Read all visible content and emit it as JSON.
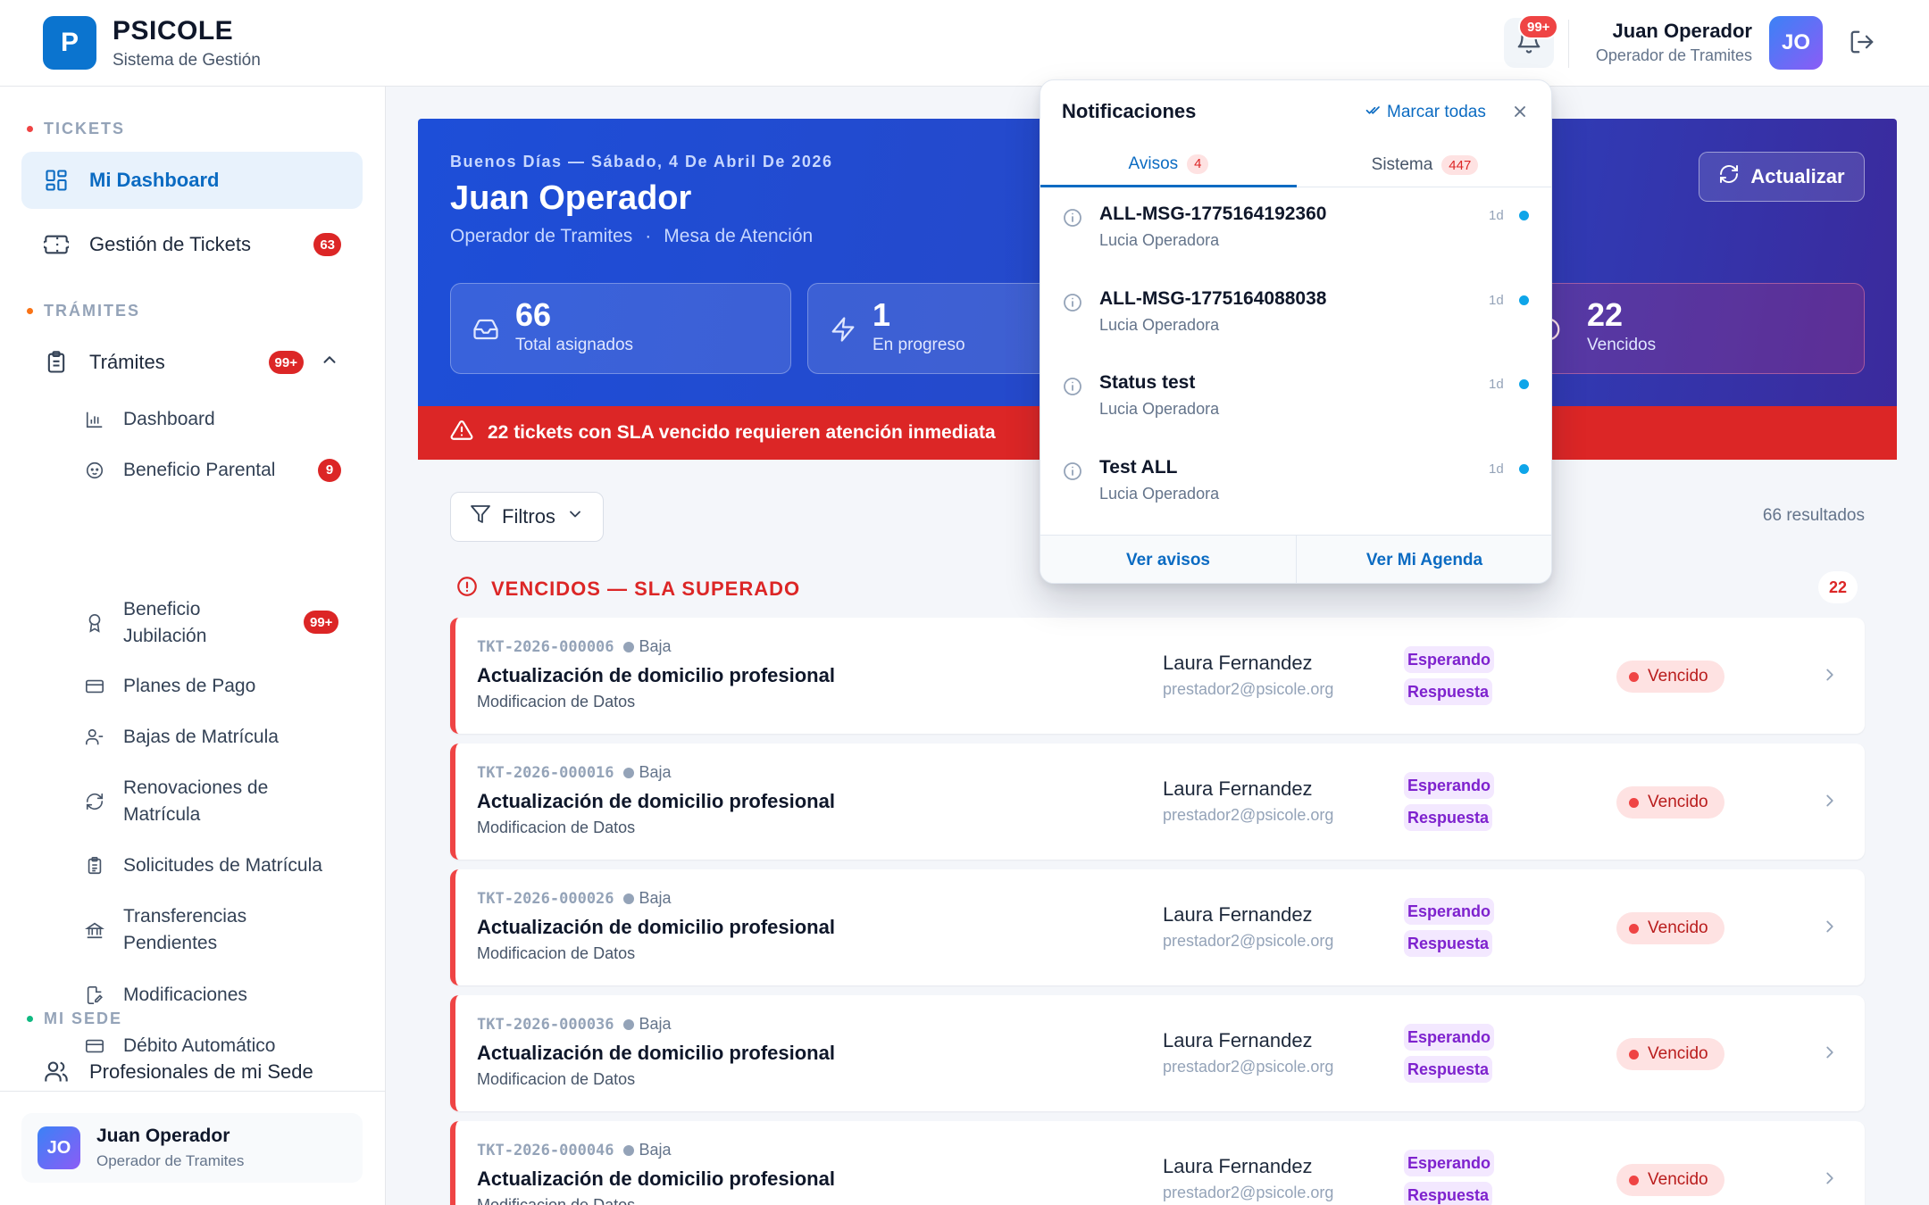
{
  "brand": {
    "logo_letter": "P",
    "name": "PSICOLE",
    "subtitle": "Sistema de Gestión"
  },
  "topbar": {
    "notification_badge": "99+",
    "user_name": "Juan Operador",
    "user_role": "Operador de Tramites",
    "user_initials": "JO"
  },
  "sidebar": {
    "sections": [
      {
        "title": "TICKETS",
        "dot_color": "#ef4444"
      },
      {
        "title": "TRÁMITES",
        "dot_color": "#f97316"
      },
      {
        "title": "MI SEDE",
        "dot_color": "#10b981"
      }
    ],
    "items": [
      {
        "label": "Mi Dashboard",
        "icon": "dashboard-icon",
        "active": true
      },
      {
        "label": "Gestión de Tickets",
        "icon": "ticket-icon",
        "badge": "63"
      },
      {
        "label": "Trámites",
        "icon": "clipboard-icon",
        "badge": "99+",
        "expanded": true
      },
      {
        "label": "Profesionales de mi Sede",
        "icon": "users-icon"
      }
    ],
    "tramites_sub": [
      {
        "label": "Dashboard",
        "icon": "bar-chart-icon"
      },
      {
        "label": "Beneficio Parental",
        "icon": "baby-icon",
        "badge": "9"
      },
      {
        "label": "Beneficio Jubilación",
        "icon": "award-icon",
        "badge": "99+"
      },
      {
        "label": "Planes de Pago",
        "icon": "credit-card-icon"
      },
      {
        "label": "Bajas de Matrícula",
        "icon": "user-minus-icon"
      },
      {
        "label": "Renovaciones de Matrícula",
        "icon": "refresh-icon"
      },
      {
        "label": "Solicitudes de Matrícula",
        "icon": "clipboard-list-icon"
      },
      {
        "label": "Transferencias Pendientes",
        "icon": "bank-icon"
      },
      {
        "label": "Modificaciones",
        "icon": "file-edit-icon"
      },
      {
        "label": "Débito Automático",
        "icon": "credit-card-icon"
      }
    ],
    "footer": {
      "initials": "JO",
      "name": "Juan Operador",
      "role": "Operador de Tramites"
    }
  },
  "hero": {
    "greeting": "Buenos Días — Sábado, 4 De Abril De 2026",
    "name": "Juan Operador",
    "role": "Operador de Tramites",
    "separator": "·",
    "desk": "Mesa de Atención",
    "refresh_label": "Actualizar",
    "stats": [
      {
        "value": "66",
        "label": "Total asignados",
        "icon": "inbox-icon"
      },
      {
        "value": "1",
        "label": "En progreso",
        "icon": "bolt-icon"
      },
      {
        "value": "22",
        "label": "Vencidos",
        "icon": "alert-circle-icon"
      }
    ],
    "sla_warning": "22 tickets con SLA vencido requieren atención inmediata"
  },
  "filters": {
    "label": "Filtros",
    "results": "66 resultados"
  },
  "group": {
    "title": "VENCIDOS — SLA SUPERADO",
    "count": "22"
  },
  "tickets": [
    {
      "code": "TKT-2026-000006",
      "priority": "Baja",
      "title": "Actualización de domicilio profesional",
      "type": "Modificacion de Datos",
      "person": "Laura Fernandez",
      "email": "prestador2@psicole.org",
      "status_line1": "Esperando",
      "status_line2": "Respuesta",
      "due": "Vencido"
    },
    {
      "code": "TKT-2026-000016",
      "priority": "Baja",
      "title": "Actualización de domicilio profesional",
      "type": "Modificacion de Datos",
      "person": "Laura Fernandez",
      "email": "prestador2@psicole.org",
      "status_line1": "Esperando",
      "status_line2": "Respuesta",
      "due": "Vencido"
    },
    {
      "code": "TKT-2026-000026",
      "priority": "Baja",
      "title": "Actualización de domicilio profesional",
      "type": "Modificacion de Datos",
      "person": "Laura Fernandez",
      "email": "prestador2@psicole.org",
      "status_line1": "Esperando",
      "status_line2": "Respuesta",
      "due": "Vencido"
    },
    {
      "code": "TKT-2026-000036",
      "priority": "Baja",
      "title": "Actualización de domicilio profesional",
      "type": "Modificacion de Datos",
      "person": "Laura Fernandez",
      "email": "prestador2@psicole.org",
      "status_line1": "Esperando",
      "status_line2": "Respuesta",
      "due": "Vencido"
    },
    {
      "code": "TKT-2026-000046",
      "priority": "Baja",
      "title": "Actualización de domicilio profesional",
      "type": "Modificacion de Datos",
      "person": "Laura Fernandez",
      "email": "prestador2@psicole.org",
      "status_line1": "Esperando",
      "status_line2": "Respuesta",
      "due": "Vencido"
    }
  ],
  "notifications": {
    "title": "Notificaciones",
    "mark_all": "Marcar todas",
    "tabs": [
      {
        "label": "Avisos",
        "count": "4",
        "active": true
      },
      {
        "label": "Sistema",
        "count": "447",
        "active": false
      }
    ],
    "items": [
      {
        "title": "ALL-MSG-1775164192360",
        "from": "Lucia Operadora",
        "age": "1d"
      },
      {
        "title": "ALL-MSG-1775164088038",
        "from": "Lucia Operadora",
        "age": "1d"
      },
      {
        "title": "Status test",
        "from": "Lucia Operadora",
        "age": "1d"
      },
      {
        "title": "Test ALL",
        "from": "Lucia Operadora",
        "age": "1d"
      }
    ],
    "footer": {
      "left": "Ver avisos",
      "right": "Ver Mi Agenda"
    }
  },
  "colors": {
    "primary": "#0b74cf",
    "danger": "#dc2626",
    "hero_from": "#1d4ed8",
    "hero_to": "#3b2a9c",
    "status_purple": "#7e22ce"
  }
}
